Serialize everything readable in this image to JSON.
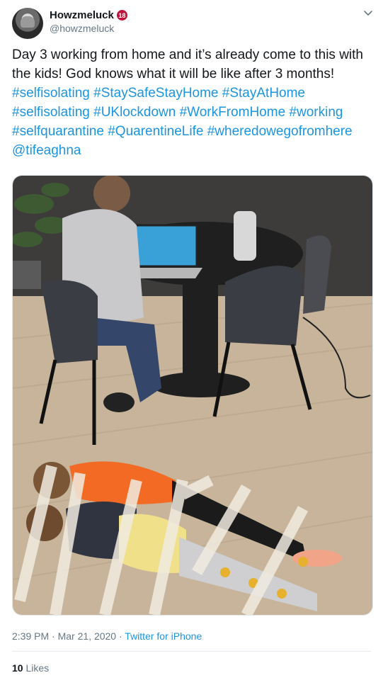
{
  "user": {
    "display_name": "Howzmeluck",
    "badge": "18",
    "handle": "@howzmeluck"
  },
  "tweet": {
    "text_plain": "Day 3 working from home and it’s already come to this with the kids! God knows what it will be like after 3 months!",
    "hashtags": [
      "#selfisolating",
      "#StaySafeStayHome",
      "#StayAtHome",
      "#selfisolating",
      "#UKlockdown",
      "#WorkFromHome",
      "#working",
      "#selfquarantine",
      "#QuarentineLife",
      "#wheredowegofromhere",
      "@tifeaghna"
    ]
  },
  "meta": {
    "time": "2:39 PM",
    "date": "Mar 21, 2020",
    "source": "Twitter for iPhone",
    "separator": "·"
  },
  "likes": {
    "count": "10",
    "label": "Likes"
  },
  "icons": {
    "menu": "chevron-down-icon"
  },
  "colors": {
    "link": "#1b95e0",
    "muted": "#657786",
    "badge": "#c0143c"
  }
}
